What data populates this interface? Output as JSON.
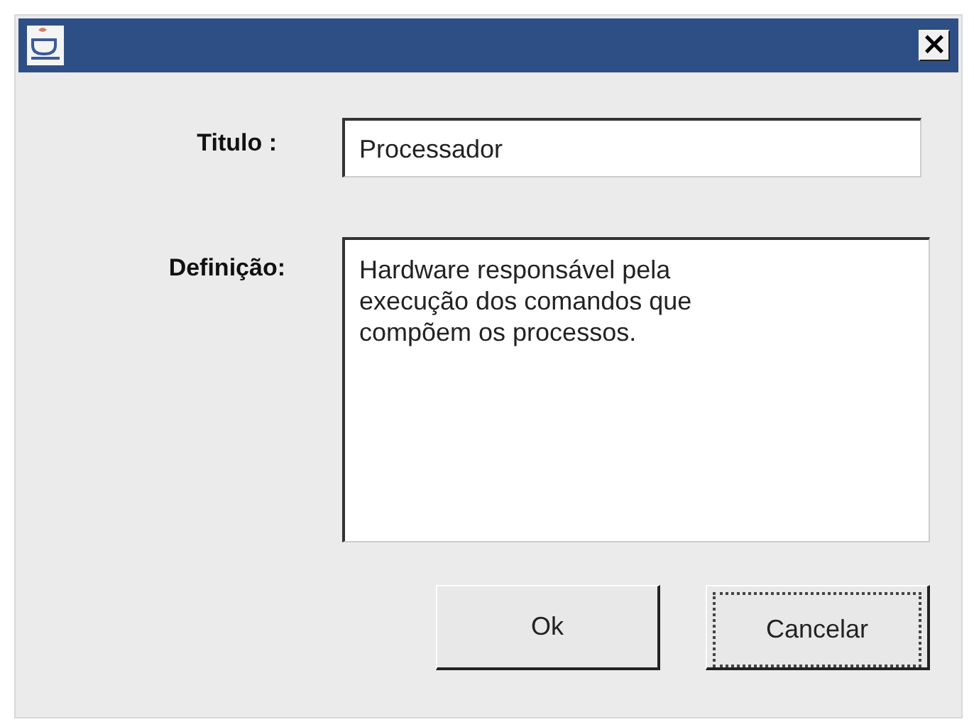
{
  "window": {
    "close": "×"
  },
  "fields": [
    {
      "label": "Titulo :",
      "kind": "line",
      "value": "Processador"
    },
    {
      "label": "Definição:",
      "kind": "area",
      "value": "Hardware responsável pela\nexecução dos comandos que\ncompõem os processos."
    }
  ],
  "buttons": [
    {
      "label": "Ok",
      "focused": false
    },
    {
      "label": "Cancelar",
      "focused": true
    }
  ]
}
